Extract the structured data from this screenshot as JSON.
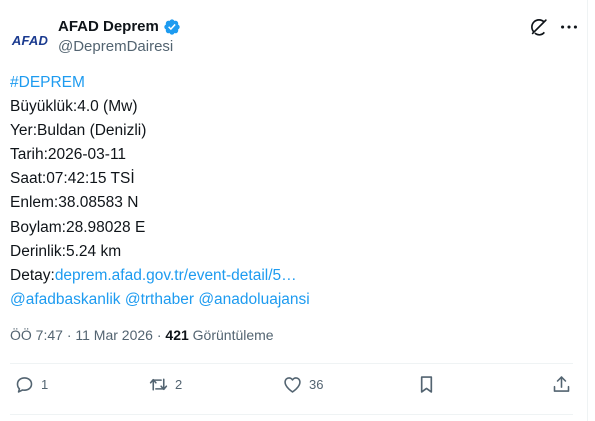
{
  "author": {
    "avatar_text": "AFAD",
    "display_name": "AFAD Deprem",
    "handle": "@DepremDairesi"
  },
  "tweet": {
    "hashtag": "#DEPREM",
    "lines": [
      "Büyüklük:4.0 (Mw)",
      "Yer:Buldan (Denizli)",
      "Tarih:2026-03-11",
      "Saat:07:42:15 TSİ",
      "Enlem:38.08583 N",
      "Boylam:28.98028 E",
      "Derinlik:5.24 km"
    ],
    "detail_label": "Detay:",
    "detail_link": "deprem.afad.gov.tr/event-detail/5…",
    "mentions": [
      "@afadbaskanlik",
      "@trthaber",
      "@anadoluajansi"
    ]
  },
  "meta": {
    "time": "ÖÖ 7:47",
    "separator": "·",
    "date": "11 Mar 2026",
    "views_count": "421",
    "views_label": "Görüntüleme"
  },
  "actions": {
    "reply_count": "1",
    "retweet_count": "2",
    "like_count": "36"
  },
  "colors": {
    "accent": "#1d9bf0",
    "text": "#0f1419",
    "secondary": "#536471",
    "verified": "#1d9bf0"
  }
}
